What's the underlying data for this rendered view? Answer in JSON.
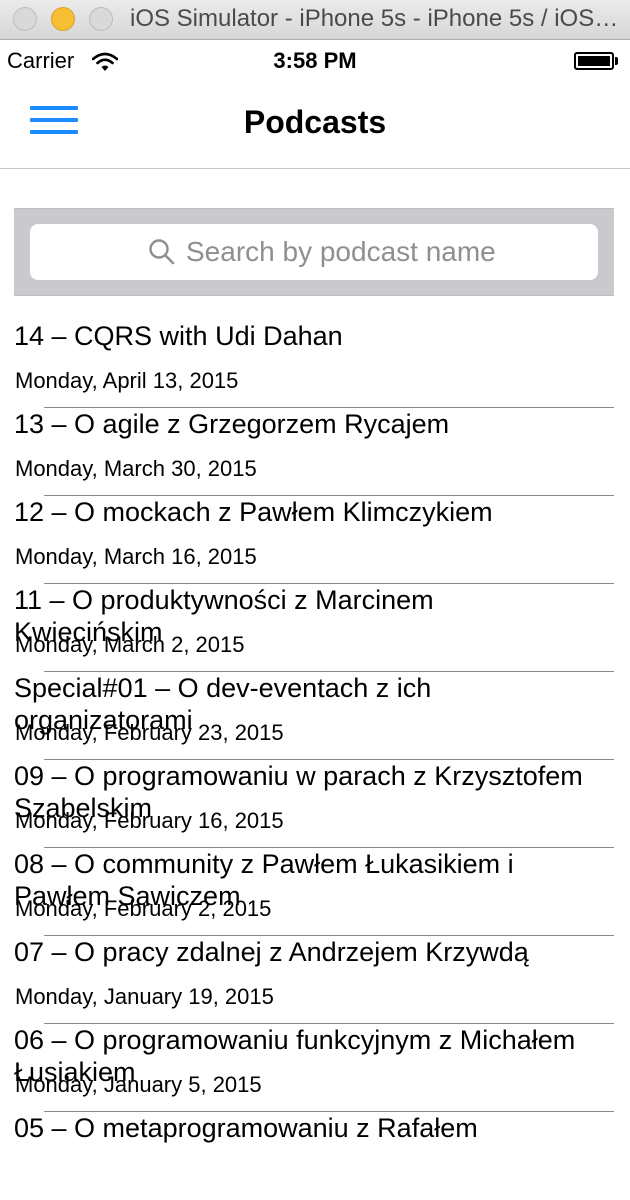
{
  "window": {
    "title": "iOS Simulator - iPhone 5s - iPhone 5s / iOS 8.3 (12F69)"
  },
  "status_bar": {
    "carrier": "Carrier",
    "time": "3:58 PM"
  },
  "nav": {
    "title": "Podcasts"
  },
  "search": {
    "placeholder": "Search by podcast name",
    "value": ""
  },
  "podcasts": [
    {
      "title": "14 – CQRS with Udi Dahan",
      "date": "Monday, April 13, 2015"
    },
    {
      "title": "13 – O agile z Grzegorzem Rycajem",
      "date": "Monday, March 30, 2015"
    },
    {
      "title": "12 – O mockach z Pawłem Klimczykiem",
      "date": "Monday, March 16, 2015"
    },
    {
      "title": "11 – O produktywności z Marcinem Kwiecińskim",
      "date": "Monday, March 2, 2015"
    },
    {
      "title": "Special#01 – O dev-eventach z ich organizatorami",
      "date": "Monday, February 23, 2015"
    },
    {
      "title": "09 – O programowaniu w parach z Krzysztofem Szabelskim",
      "date": "Monday, February 16, 2015"
    },
    {
      "title": "08 – O community z Pawłem Łukasikiem i Pawłem Sawiczem",
      "date": "Monday, February 2, 2015"
    },
    {
      "title": "07 – O pracy zdalnej z Andrzejem Krzywdą",
      "date": "Monday, January 19, 2015"
    },
    {
      "title": "06 – O programowaniu funkcyjnym z Michałem Łusiakiem",
      "date": "Monday, January 5, 2015"
    },
    {
      "title": "05 – O metaprogramowaniu z Rafałem",
      "date": ""
    }
  ],
  "colors": {
    "tint": "#1a8cff",
    "searchbar_bg": "#c9c9ce",
    "placeholder": "#8e8e93"
  },
  "icons": {
    "menu": "hamburger-menu-icon",
    "search": "search-icon",
    "wifi": "wifi-icon",
    "battery": "battery-icon"
  }
}
